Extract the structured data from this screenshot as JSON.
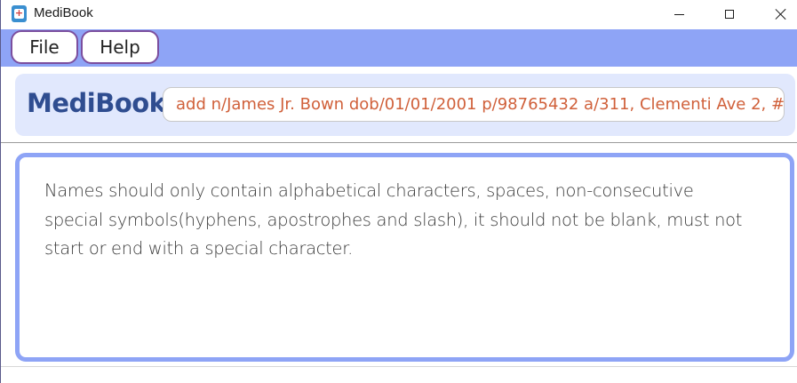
{
  "window": {
    "title": "MediBook",
    "app_icon": "medibook-app-icon",
    "controls": [
      "minimize-icon",
      "maximize-icon",
      "close-icon"
    ]
  },
  "menu": {
    "items": [
      {
        "label": "File"
      },
      {
        "label": "Help"
      }
    ]
  },
  "command": {
    "brand": "MediBook",
    "input_value": "add n/James Jr. Bown dob/01/01/2001 p/98765432 a/311, Clementi Ave 2, #"
  },
  "result": {
    "message": "Names should only contain alphabetical characters, spaces, non-consecutive special symbols(hyphens, apostrophes and slash), it should not be blank, must not start or end with a special character."
  },
  "colors": {
    "accent": "#8ea4f6",
    "brand": "#2f4d90",
    "command_text": "#d0603a",
    "menu_border": "#7b4e9e",
    "panel_bg": "#e1e8fd"
  }
}
